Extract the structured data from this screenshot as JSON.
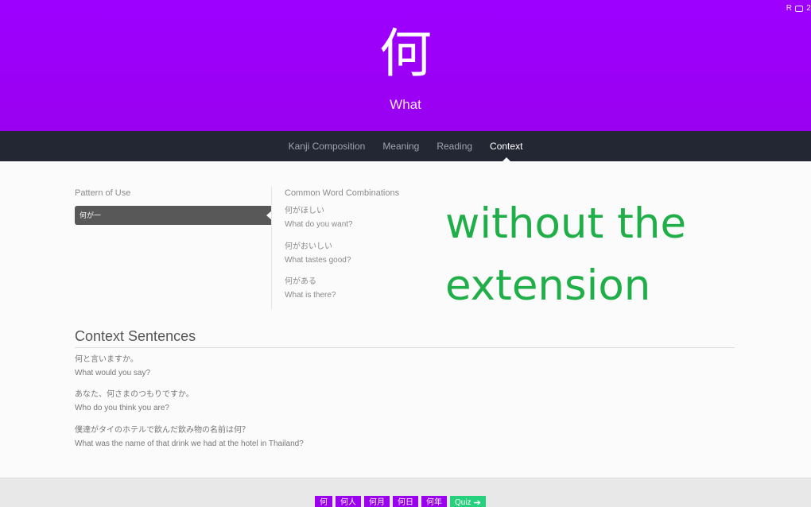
{
  "hero": {
    "kanji": "何",
    "meaning": "What"
  },
  "corner": {
    "label": "R",
    "count": "2"
  },
  "nav": {
    "tabs": [
      "Kanji Composition",
      "Meaning",
      "Reading",
      "Context"
    ],
    "active": "Context"
  },
  "pattern": {
    "label": "Pattern of Use",
    "items": [
      "何が一"
    ]
  },
  "combinations": {
    "label": "Common Word Combinations",
    "items": [
      {
        "jp": "何がほしい",
        "en": "What do you want?"
      },
      {
        "jp": "何がおいしい",
        "en": "What tastes good?"
      },
      {
        "jp": "何がある",
        "en": "What is there?"
      }
    ]
  },
  "overlay": {
    "line1": "without the",
    "line2": "extension"
  },
  "context": {
    "title": "Context Sentences",
    "sentences": [
      {
        "jp": "何と言いますか。",
        "en": "What would you say?"
      },
      {
        "jp": "あなた、何さまのつもりですか。",
        "en": "Who do you think you are?"
      },
      {
        "jp": "僕達がタイのホテルで飲んだ飲み物の名前は何？",
        "en": "What was the name of that drink we had at the hotel in Thailand?"
      }
    ]
  },
  "footer": {
    "chips": [
      "何",
      "何人",
      "何月",
      "何日",
      "何年"
    ],
    "quiz": "Quiz"
  },
  "colors": {
    "hero": "#9d00ff",
    "nav": "#232733",
    "overlay": "#1fae48",
    "chip": "#9a00ee",
    "quiz": "#26d07c"
  }
}
